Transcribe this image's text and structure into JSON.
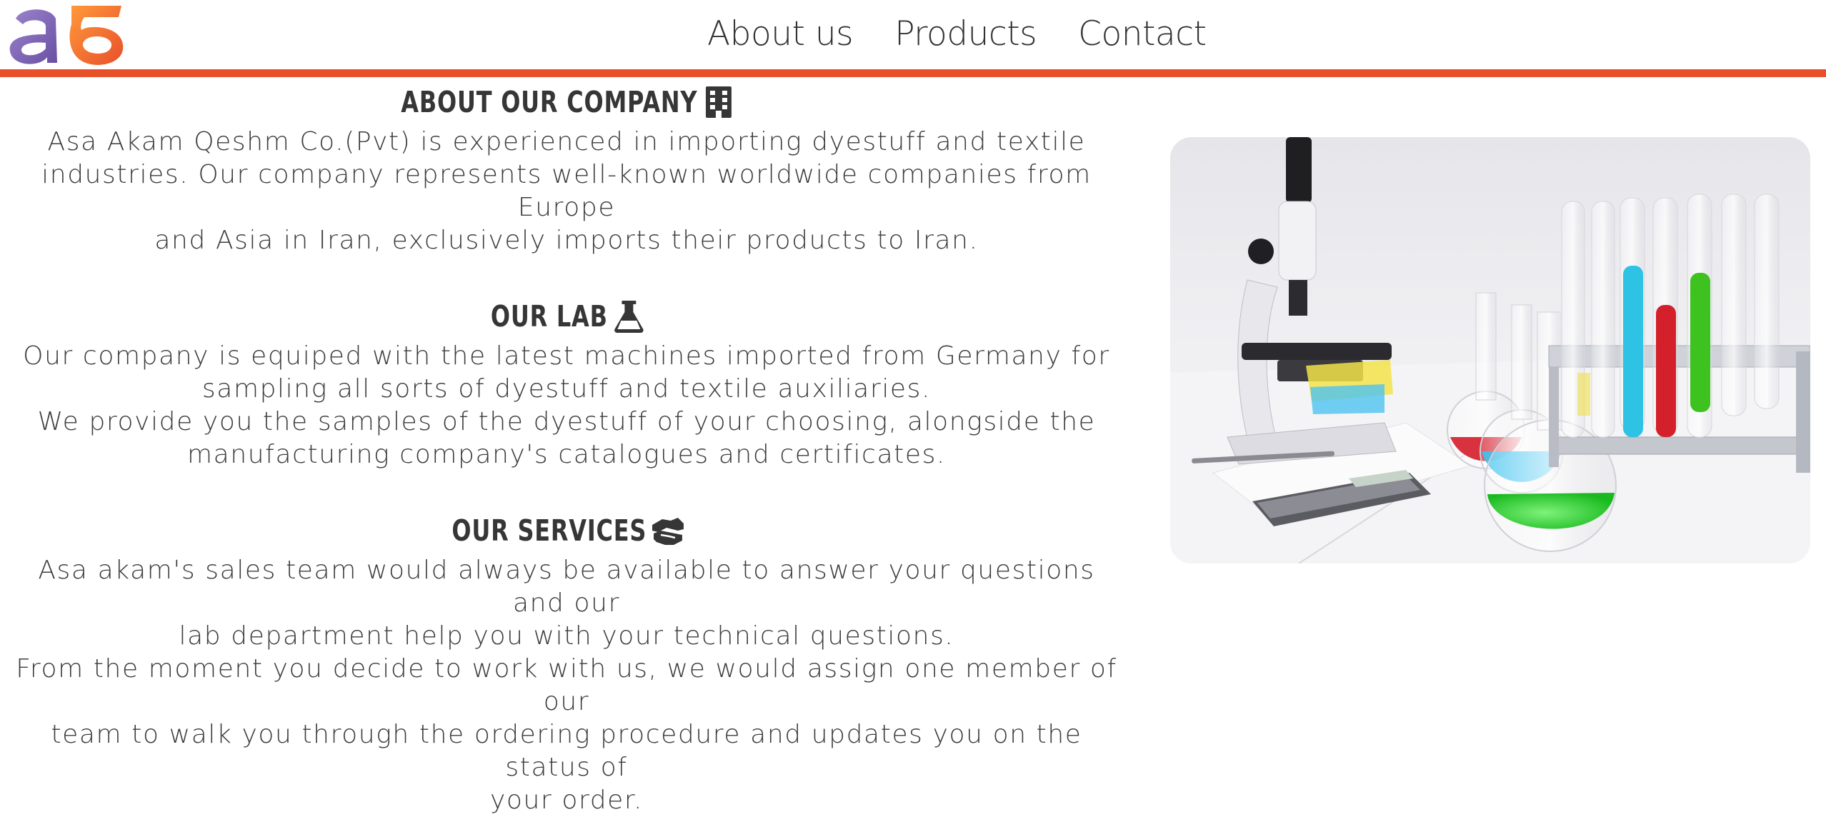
{
  "header": {
    "logo_text": "aб",
    "nav": [
      {
        "label": "About us"
      },
      {
        "label": "Products"
      },
      {
        "label": "Contact"
      }
    ]
  },
  "colors": {
    "accent": "#e8502a",
    "logo_purple": "#7f62b6",
    "logo_orange": "#f07a28",
    "text": "#3c3c3c"
  },
  "sections": {
    "company": {
      "title": "ABOUT OUR COMPANY",
      "icon": "building-icon",
      "lines": [
        "Asa Akam Qeshm Co.(Pvt) is experienced in importing dyestuff and textile",
        "industries. Our company represents well-known worldwide companies from Europe",
        "and Asia in Iran, exclusively imports their products to Iran."
      ]
    },
    "lab": {
      "title": "OUR LAB",
      "icon": "flask-icon",
      "lines": [
        "Our company is equiped with the latest machines imported from Germany for",
        "sampling all sorts of dyestuff and textile auxiliaries.",
        "We provide you the samples of the dyestuff of your choosing, alongside the",
        "manufacturing company's catalogues and certificates."
      ]
    },
    "services": {
      "title": "OUR SERVICES",
      "icon": "handshake-icon",
      "lines": [
        "Asa akam's sales team would always be available to answer your questions and our",
        "lab department help you with your technical questions.",
        "From the moment you decide to work with us, we would assign one member of our",
        "team to walk you through the ordering procedure and updates you on the status of",
        "your order."
      ]
    }
  },
  "image": {
    "subject": "laboratory-photo"
  }
}
